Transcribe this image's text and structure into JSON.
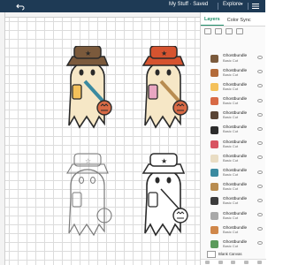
{
  "header": {
    "title": "My Stuff · Saved",
    "explore_label": "Explore"
  },
  "panel": {
    "tabs": [
      {
        "label": "Layers"
      },
      {
        "label": "Color Sync"
      }
    ],
    "layers": [
      {
        "name": "Ghostbundle",
        "subtitle": "Basic Cut",
        "color": "#7b5a3c"
      },
      {
        "name": "Ghostbundle",
        "subtitle": "Basic Cut",
        "color": "#b36b3a"
      },
      {
        "name": "Ghostbundle",
        "subtitle": "Basic Cut",
        "color": "#f4c15a"
      },
      {
        "name": "Ghostbundle",
        "subtitle": "Basic Cut",
        "color": "#d86a45"
      },
      {
        "name": "Ghostbundle",
        "subtitle": "Basic Cut",
        "color": "#5a4535"
      },
      {
        "name": "Ghostbundle",
        "subtitle": "Basic Cut",
        "color": "#2b2b2b"
      },
      {
        "name": "Ghostbundle",
        "subtitle": "Basic Cut",
        "color": "#d85462"
      },
      {
        "name": "Ghostbundle",
        "subtitle": "Basic Cut",
        "color": "#e9ddc4"
      },
      {
        "name": "Ghostbundle",
        "subtitle": "Basic Cut",
        "color": "#3a8aa0"
      },
      {
        "name": "Ghostbundle",
        "subtitle": "Basic Cut",
        "color": "#b88c50"
      },
      {
        "name": "Ghostbundle",
        "subtitle": "Basic Cut",
        "color": "#3c3c3c"
      },
      {
        "name": "Ghostbundle",
        "subtitle": "Basic Cut",
        "color": "#a8a8a8"
      },
      {
        "name": "Ghostbundle",
        "subtitle": "Basic Cut",
        "color": "#d0874a"
      },
      {
        "name": "Ghostbundle",
        "subtitle": "Basic Cut",
        "color": "#5b9a5b"
      }
    ],
    "blank_canvas_label": "Blank Canvas"
  }
}
